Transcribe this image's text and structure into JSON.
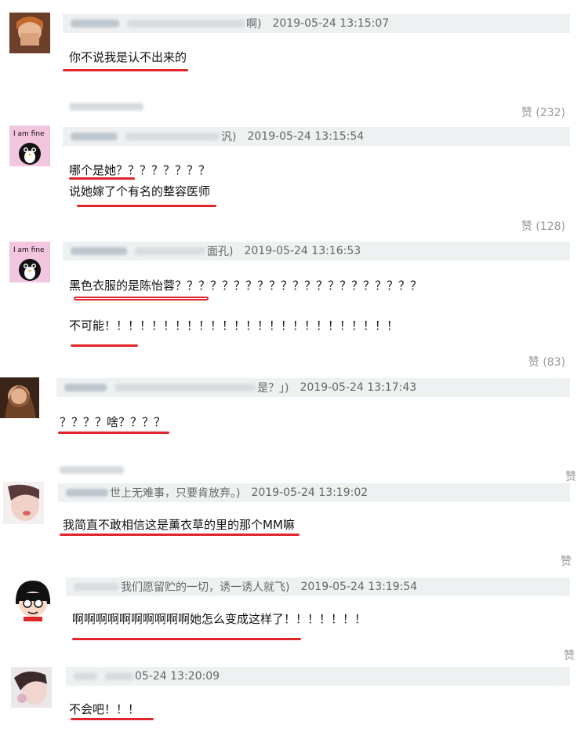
{
  "comments": [
    {
      "meta_tail": "啊)",
      "time": "2019-05-24 13:15:07",
      "lines": [
        "你不说我是认不出来的"
      ],
      "likes": "赞 (232)"
    },
    {
      "meta_tail": "汎)",
      "time": "2019-05-24 13:15:54",
      "lines": [
        "哪个是她？？？？？？？？",
        "说她嫁了个有名的整容医师"
      ],
      "likes": "赞 (128)",
      "avatar_text": "I am fine"
    },
    {
      "meta_tail": "面孔)",
      "time": "2019-05-24 13:16:53",
      "lines": [
        "黑色衣服的是陈怡蓉？？？？？？？？？？？？？？？？？？？？？",
        "不可能！！！！！！！！！！！！！！！！！！！！！！！！！"
      ],
      "likes": "赞 (83)",
      "avatar_text": "I am fine"
    },
    {
      "meta_tail": "是？」)",
      "time": "2019-05-24 13:17:43",
      "lines": [
        "？？？？啥？？？？"
      ],
      "likes": "赞"
    },
    {
      "meta_tail": "世上无难事，只要肯放弃。)",
      "time": "2019-05-24 13:19:02",
      "lines": [
        "我简直不敢相信这是薰衣草的里的那个MM嘛"
      ],
      "likes": "赞"
    },
    {
      "meta_tail": "我们愿留贮的一切，诱一诱人就飞)",
      "time": "2019-05-24 13:19:54",
      "lines": [
        "啊啊啊啊啊啊啊啊啊啊她怎么变成这样了！！！！！！！"
      ],
      "likes": "赞"
    },
    {
      "meta_tail": "05-24 13:20:09",
      "time": "",
      "lines": [
        "不会吧！！！"
      ]
    }
  ]
}
